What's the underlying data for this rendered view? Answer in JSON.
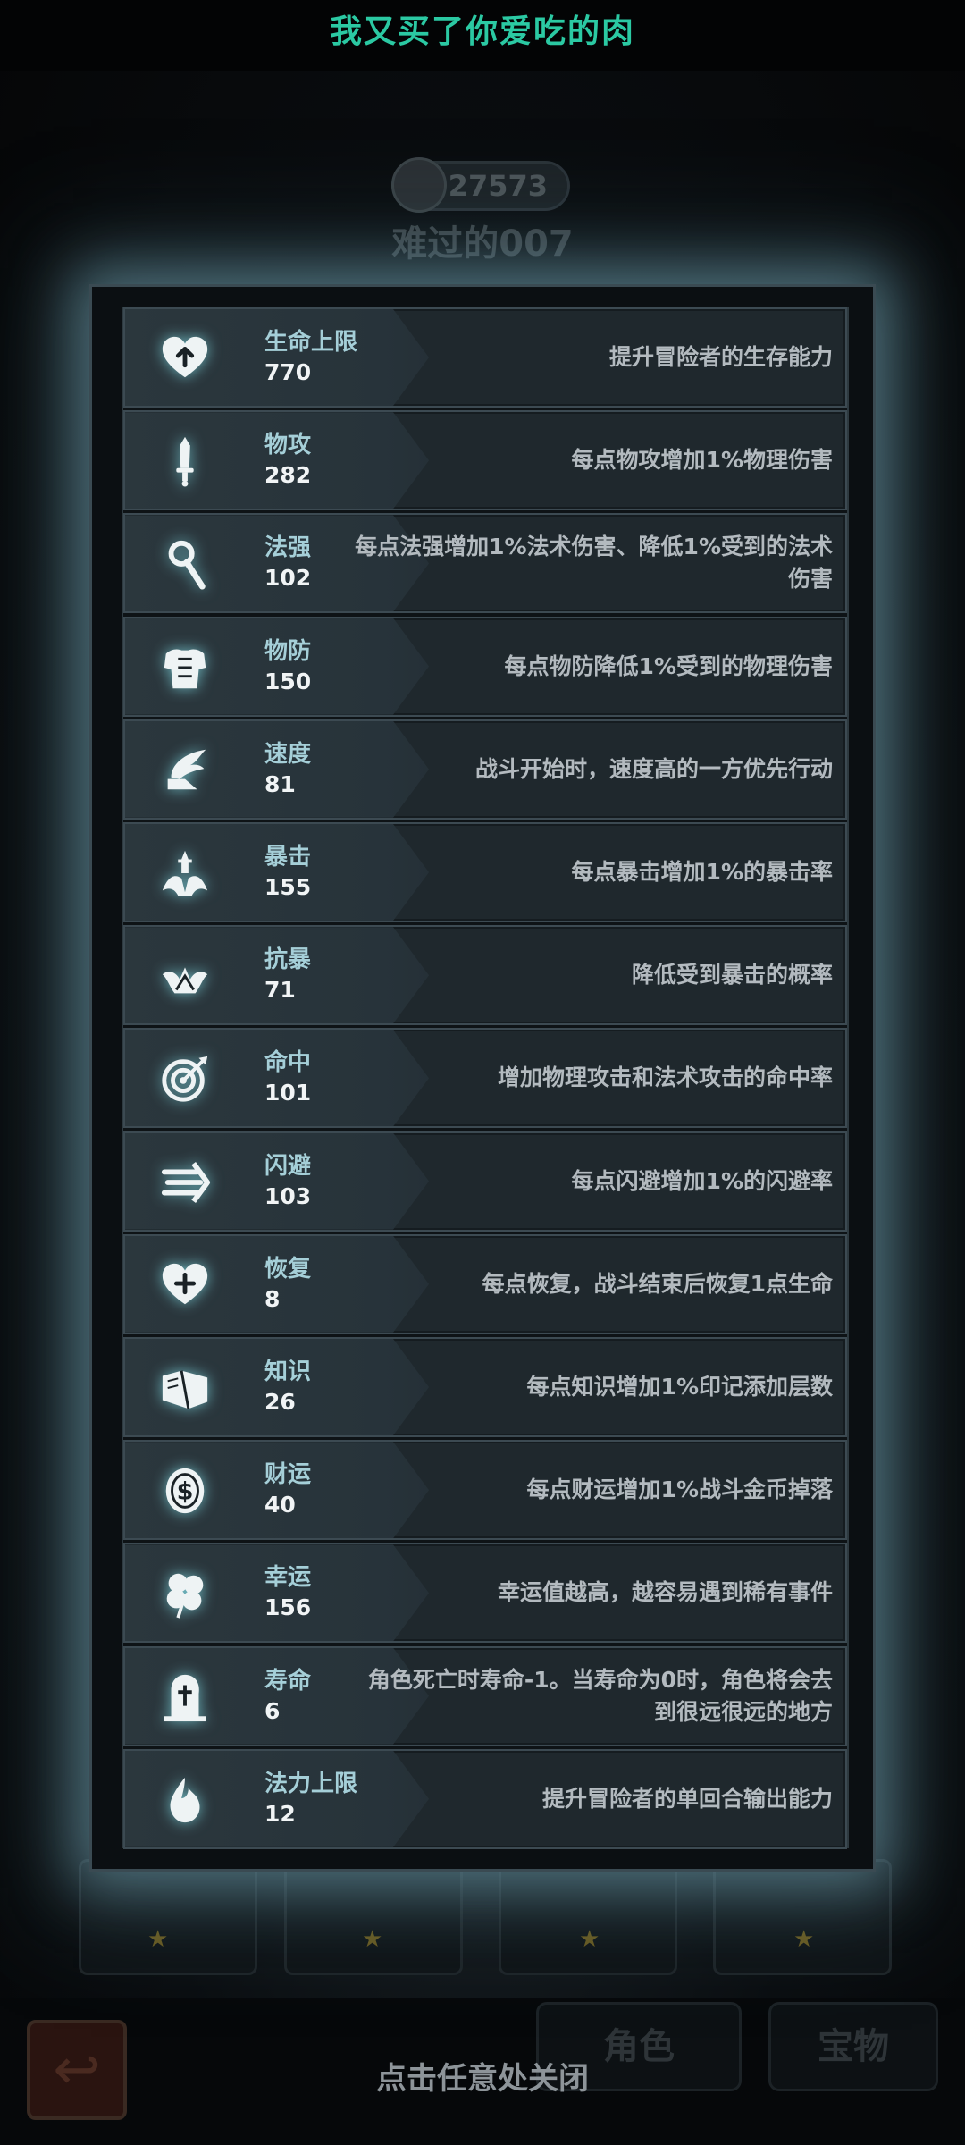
{
  "header": {
    "title": "我又买了你爱吃的肉"
  },
  "background": {
    "power_value": "27573",
    "character_name": "难过的007",
    "tabs": [
      "角色",
      "宝物"
    ]
  },
  "close_hint": "点击任意处关闭",
  "stats": [
    {
      "name": "生命上限",
      "value": "770",
      "desc": "提升冒险者的生存能力",
      "icon": "heart-up-icon"
    },
    {
      "name": "物攻",
      "value": "282",
      "desc": "每点物攻增加1%物理伤害",
      "icon": "sword-icon"
    },
    {
      "name": "法强",
      "value": "102",
      "desc": "每点法强增加1%法术伤害、降低1%受到的法术伤害",
      "icon": "staff-icon"
    },
    {
      "name": "物防",
      "value": "150",
      "desc": "每点物防降低1%受到的物理伤害",
      "icon": "armor-icon"
    },
    {
      "name": "速度",
      "value": "81",
      "desc": "战斗开始时，速度高的一方优先行动",
      "icon": "winged-boot-icon"
    },
    {
      "name": "暴击",
      "value": "155",
      "desc": "每点暴击增加1%的暴击率",
      "icon": "crit-burst-icon"
    },
    {
      "name": "抗暴",
      "value": "71",
      "desc": "降低受到暴击的概率",
      "icon": "crit-resist-icon"
    },
    {
      "name": "命中",
      "value": "101",
      "desc": "增加物理攻击和法术攻击的命中率",
      "icon": "target-icon"
    },
    {
      "name": "闪避",
      "value": "103",
      "desc": "每点闪避增加1%的闪避率",
      "icon": "dodge-arrows-icon"
    },
    {
      "name": "恢复",
      "value": "8",
      "desc": "每点恢复，战斗结束后恢复1点生命",
      "icon": "heart-plus-icon"
    },
    {
      "name": "知识",
      "value": "26",
      "desc": "每点知识增加1%印记添加层数",
      "icon": "book-icon"
    },
    {
      "name": "财运",
      "value": "40",
      "desc": "每点财运增加1%战斗金币掉落",
      "icon": "coin-icon"
    },
    {
      "name": "幸运",
      "value": "156",
      "desc": "幸运值越高，越容易遇到稀有事件",
      "icon": "clover-icon"
    },
    {
      "name": "寿命",
      "value": "6",
      "desc": "角色死亡时寿命-1。当寿命为0时，角色将会去到很远很远的地方",
      "icon": "tombstone-icon"
    },
    {
      "name": "法力上限",
      "value": "12",
      "desc": "提升冒险者的单回合输出能力",
      "icon": "mana-drop-icon"
    }
  ]
}
